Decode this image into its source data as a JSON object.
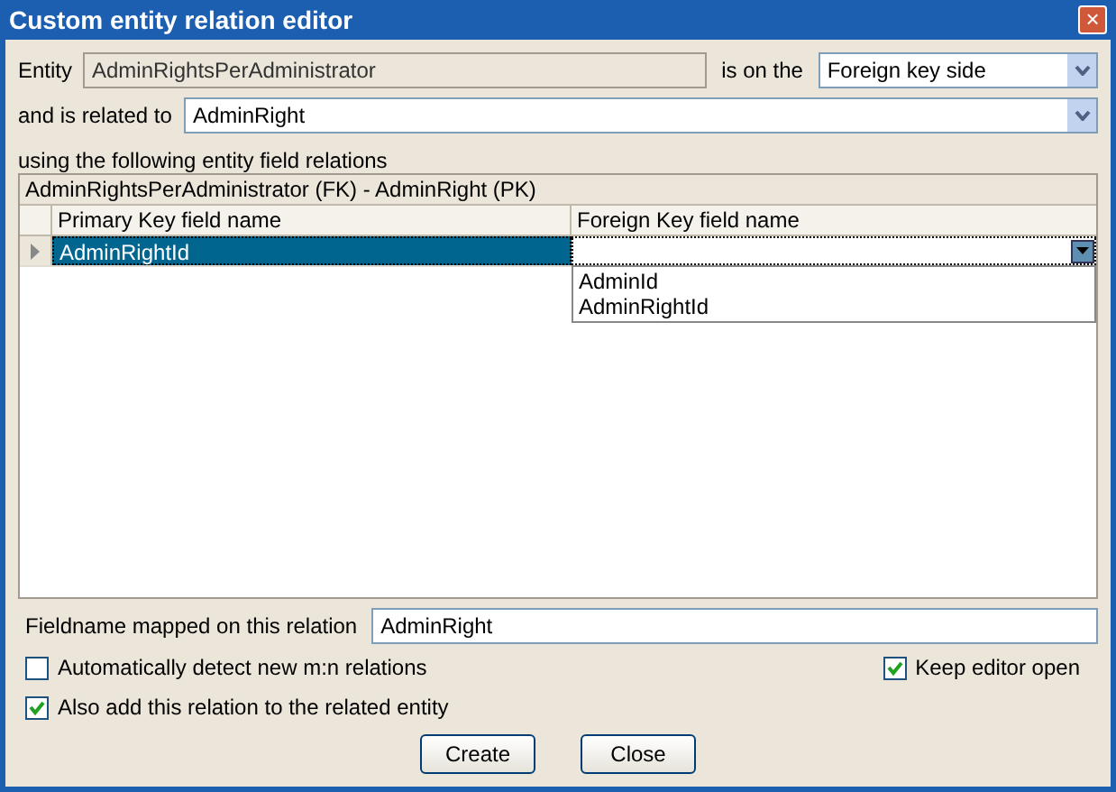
{
  "window": {
    "title": "Custom entity relation editor",
    "close": "×"
  },
  "entity": {
    "label": "Entity",
    "value": "AdminRightsPerAdministrator"
  },
  "side": {
    "label": "is on the",
    "value": "Foreign key side"
  },
  "related": {
    "label": "and is related to",
    "value": "AdminRight"
  },
  "relations_label": "using the following entity field relations",
  "grid": {
    "caption": "AdminRightsPerAdministrator (FK) - AdminRight (PK)",
    "columns": [
      "Primary Key field name",
      "Foreign Key field name"
    ],
    "rows": [
      {
        "cells": [
          "AdminRightId",
          ""
        ],
        "selected": true
      }
    ],
    "dropdown": [
      "AdminId",
      "AdminRightId"
    ]
  },
  "fieldname": {
    "label": "Fieldname mapped on this relation",
    "value": "AdminRight"
  },
  "options": [
    {
      "label": "Automatically detect new m:n relations",
      "checked": false
    },
    {
      "label": "Keep editor open",
      "checked": true
    },
    {
      "label": "Also add this relation to the related entity",
      "checked": true
    }
  ],
  "buttons": [
    "Create",
    "Close"
  ]
}
